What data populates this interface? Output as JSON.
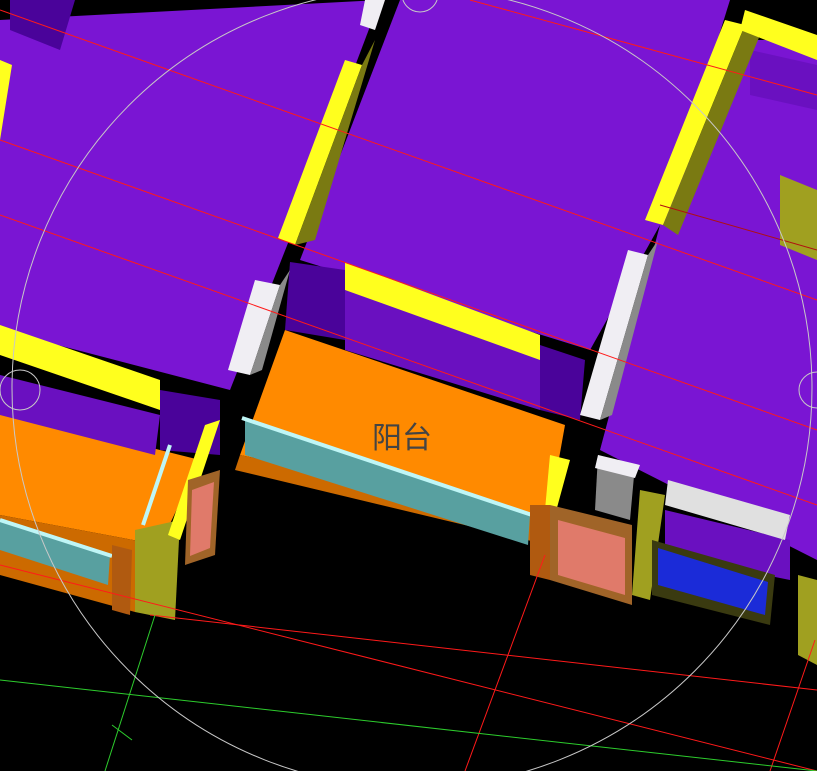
{
  "labels": {
    "balcony": "阳台"
  },
  "colors": {
    "background": "#000000",
    "slab": "#7a15d3",
    "slab_dark": "#4a039a",
    "beam_light": "#ffff1e",
    "beam_side": "#7a7a12",
    "column_light": "#f0eef3",
    "column_side": "#8a8a8a",
    "balcony_floor": "#ff8a00",
    "balcony_edge": "#cc6a00",
    "railing": "#58a0a0",
    "railing_cap": "#bff6f6",
    "door": "#e07a6a",
    "frame": "#a06428",
    "window": "#1b2bd8",
    "grid_axis": "#ff1a1a",
    "grid_axis_dark": "#b01010",
    "grid_axis_alt": "#2dcc2d",
    "guide_circle": "#c8c8c8",
    "label_text": "#444444"
  }
}
